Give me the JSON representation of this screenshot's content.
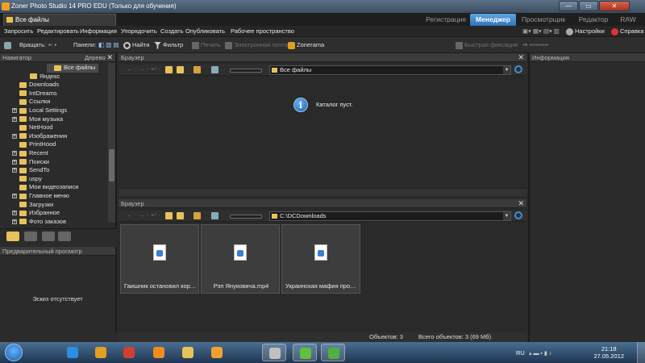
{
  "window": {
    "title": "Zoner Photo Studio 14 PRO EDU (Только для обучения)",
    "btn_min": "—",
    "btn_max": "▭",
    "btn_close": "✕"
  },
  "tabs": {
    "document": "Все файлы",
    "modes": [
      "Регистрация",
      "Менеджер",
      "Просмотрщик",
      "Редактор",
      "RAW"
    ],
    "active_mode": "Менеджер",
    "accent": "#3b8fd6"
  },
  "menu": {
    "items": [
      "Запросить",
      "Редактировать",
      "Информация",
      "Упорядочить",
      "Создать",
      "Опубликовать",
      "Рабочее пространство"
    ],
    "right": [
      "Настройки",
      "Справка"
    ]
  },
  "toolbar": {
    "rotate": "Вращать:",
    "panels": "Панели:",
    "find": "Найти",
    "filter": "Фильтр",
    "print": "Печать",
    "email": "Электронная почта",
    "zonerama": "Zonerama",
    "quick_fix": "Быстрая фиксация"
  },
  "navigator": {
    "header": "Навигатор",
    "view": "Дерево",
    "items": [
      {
        "label": "Все файлы",
        "indent": 2,
        "exp": "none",
        "selected": true
      },
      {
        "label": "Яндекс",
        "indent": 2,
        "exp": "none"
      },
      {
        "label": "Downloads",
        "indent": 1,
        "exp": "none"
      },
      {
        "label": "IntDreams",
        "indent": 1,
        "exp": "none"
      },
      {
        "label": "Ссылки",
        "indent": 1,
        "exp": "none"
      },
      {
        "label": "Local Settings",
        "indent": 1,
        "exp": "+"
      },
      {
        "label": "Моя музыка",
        "indent": 1,
        "exp": "+"
      },
      {
        "label": "NetHood",
        "indent": 1,
        "exp": "none"
      },
      {
        "label": "Изображения",
        "indent": 1,
        "exp": "+"
      },
      {
        "label": "PrintHood",
        "indent": 1,
        "exp": "none"
      },
      {
        "label": "Recent",
        "indent": 1,
        "exp": "+"
      },
      {
        "label": "Поиски",
        "indent": 1,
        "exp": "+"
      },
      {
        "label": "SendTo",
        "indent": 1,
        "exp": "+"
      },
      {
        "label": "uspy",
        "indent": 1,
        "exp": "none"
      },
      {
        "label": "Мои видеозаписи",
        "indent": 1,
        "exp": "none"
      },
      {
        "label": "Главное меню",
        "indent": 1,
        "exp": "+"
      },
      {
        "label": "Загрузки",
        "indent": 1,
        "exp": "none"
      },
      {
        "label": "Избранное",
        "indent": 1,
        "exp": "+"
      },
      {
        "label": "Фото заказов",
        "indent": 1,
        "exp": "+"
      }
    ]
  },
  "preview": {
    "header": "Предварительный просмотр",
    "empty": "Эскиз отсутствует"
  },
  "browser_top": {
    "header": "Браузер",
    "path": "Все файлы",
    "message": "Каталог пуст."
  },
  "browser_bottom": {
    "header": "Браузер",
    "path": "C:\\DCDownloads",
    "files": [
      "Гаишник остановил корте...",
      "Рэп Януковича.mp4",
      "Украинская мафия прослу..."
    ]
  },
  "status": {
    "objects": "Объектов: 3",
    "total": "Всего объектов: 3 (69 Мб)"
  },
  "info": {
    "header": "Информация"
  },
  "taskbar": {
    "lang": "RU",
    "time": "21:18",
    "date": "27.05.2012",
    "apps": [
      {
        "icon": "ie-icon",
        "color": "#2b8fe0"
      },
      {
        "icon": "chrome-icon",
        "color": "#e0a020"
      },
      {
        "icon": "chrome-icon",
        "color": "#d04030"
      },
      {
        "icon": "odnoklassniki-icon",
        "color": "#f08c1e"
      },
      {
        "icon": "explorer-icon",
        "color": "#e8c25a"
      },
      {
        "icon": "media-player-icon",
        "color": "#f0a030"
      },
      {
        "icon": "trinity-icon",
        "color": "#c0c0c0"
      },
      {
        "icon": "icq-icon",
        "color": "#60c040"
      },
      {
        "icon": "zoner-icon",
        "color": "#50b040"
      }
    ]
  }
}
